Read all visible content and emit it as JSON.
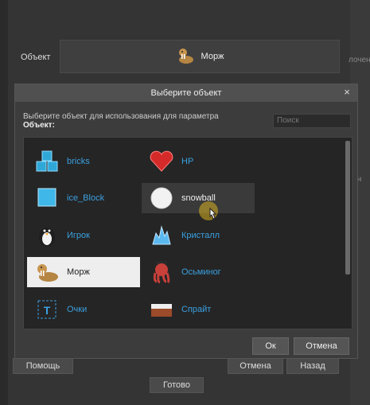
{
  "background": {
    "object_label": "Объект",
    "object_value": "Морж",
    "right_text_1": "лочен",
    "right_text_2": "чен",
    "help_button": "Помощь",
    "cancel_button": "Отмена",
    "back_button": "Назад",
    "done_button": "Готово"
  },
  "dialog": {
    "title": "Выберите объект",
    "close_glyph": "×",
    "instruction": "Выберите объект для использования для параметра",
    "field_label": "Объект:",
    "search_placeholder": "Поиск",
    "ok_button": "Ок",
    "cancel_button": "Отмена",
    "items": [
      {
        "label": "bricks",
        "icon": "bricks-icon"
      },
      {
        "label": "HP",
        "icon": "heart-icon"
      },
      {
        "label": "ice_Block",
        "icon": "ice-block-icon"
      },
      {
        "label": "snowball",
        "icon": "snowball-icon"
      },
      {
        "label": "Игрок",
        "icon": "penguin-icon"
      },
      {
        "label": "Кристалл",
        "icon": "crystal-icon"
      },
      {
        "label": "Морж",
        "icon": "walrus-icon"
      },
      {
        "label": "Осьминог",
        "icon": "octopus-icon"
      },
      {
        "label": "Очки",
        "icon": "text-t-icon"
      },
      {
        "label": "Спрайт",
        "icon": "sprite-icon"
      }
    ]
  },
  "colors": {
    "link_blue": "#3aa0e0",
    "selected_bg": "#eeeeee",
    "dialog_bg": "#3c3c3c"
  }
}
